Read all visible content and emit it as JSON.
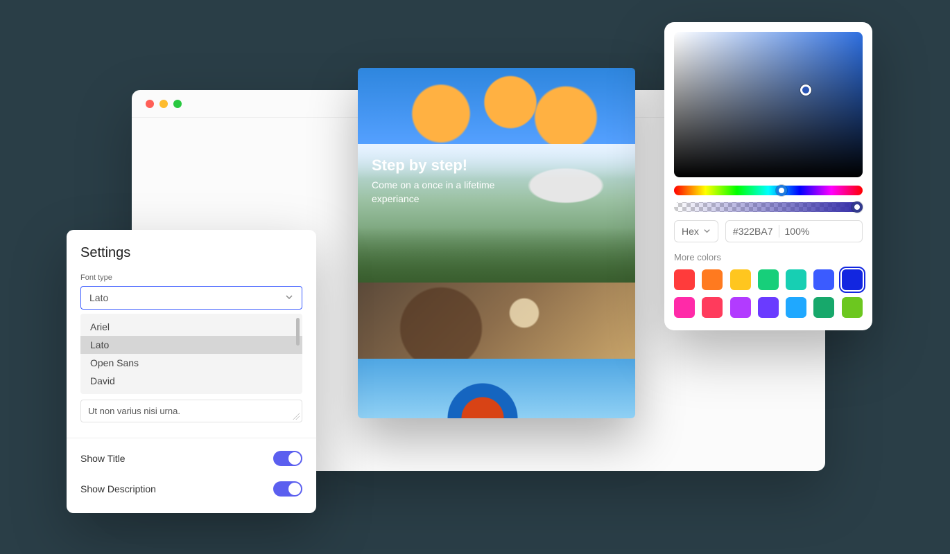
{
  "preview": {
    "title": "Step by step!",
    "subtitle": "Come on a once in a lifetime experiance"
  },
  "settings": {
    "title": "Settings",
    "font_label": "Font type",
    "font_selected": "Lato",
    "font_options": [
      "Ariel",
      "Lato",
      "Open Sans",
      "David"
    ],
    "placeholder_text": "Ut non varius nisi urna.",
    "show_title_label": "Show Title",
    "show_description_label": "Show Description",
    "show_title_on": true,
    "show_description_on": true
  },
  "picker": {
    "mode_label": "Hex",
    "hex_value": "#322BA7",
    "alpha_value": "100%",
    "more_label": "More colors",
    "swatches": [
      "#ff3b3b",
      "#ff7a1f",
      "#ffc61f",
      "#17cf7a",
      "#17cfb3",
      "#3b5bff",
      "#1226e0",
      "#ff2aa8",
      "#ff3b5c",
      "#b23bff",
      "#6a3bff",
      "#1fa8ff",
      "#17a86b",
      "#6cc71f"
    ],
    "selected_swatch_index": 6
  }
}
